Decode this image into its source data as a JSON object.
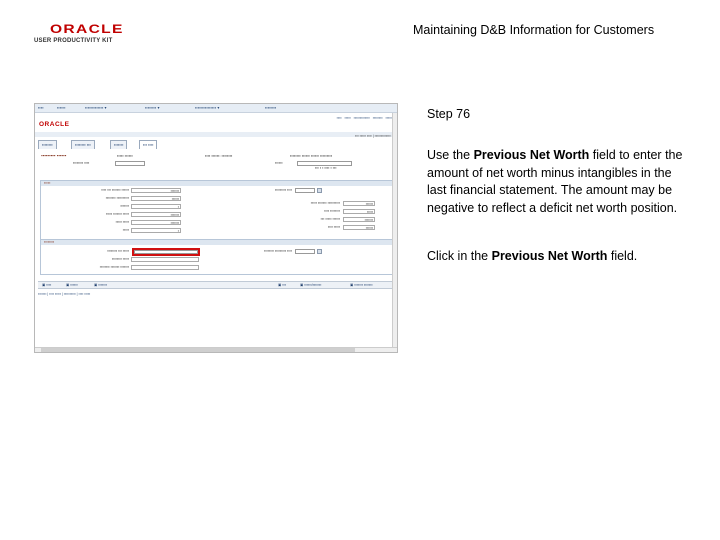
{
  "header": {
    "logo_name": "ORACLE",
    "logo_subtitle": "USER PRODUCTIVITY KIT",
    "title": "Maintaining D&B Information for Customers"
  },
  "screenshot": {
    "menu_items": [
      "Home",
      "Worklist",
      "Accounts Receivable",
      "Customers",
      "Customer Information",
      "Add/Update"
    ],
    "top_links": [
      "Home",
      "Worklist",
      "Add to Favorites",
      "Sign out"
    ],
    "tabs": [
      "General Info",
      "Bill To Options",
      "Correspondence",
      "Additional General Info"
    ],
    "page_title": "Financial Details",
    "fields_visible": [
      "SetID",
      "Customer ID",
      "DUNS Number",
      "Previous Net Worth",
      "Previous Sales",
      "Previous Working Capital"
    ],
    "highlighted_field": "Previous Net Worth"
  },
  "instructions": {
    "step": "Step 76",
    "p1_pre": "Use the ",
    "p1_bold": "Previous Net Worth",
    "p1_post": " field to enter the amount of net worth minus intangibles in the last financial statement. The amount may be negative to reflect a deficit net worth position.",
    "p2_pre": "Click in the ",
    "p2_bold": "Previous Net Worth",
    "p2_post": " field."
  }
}
